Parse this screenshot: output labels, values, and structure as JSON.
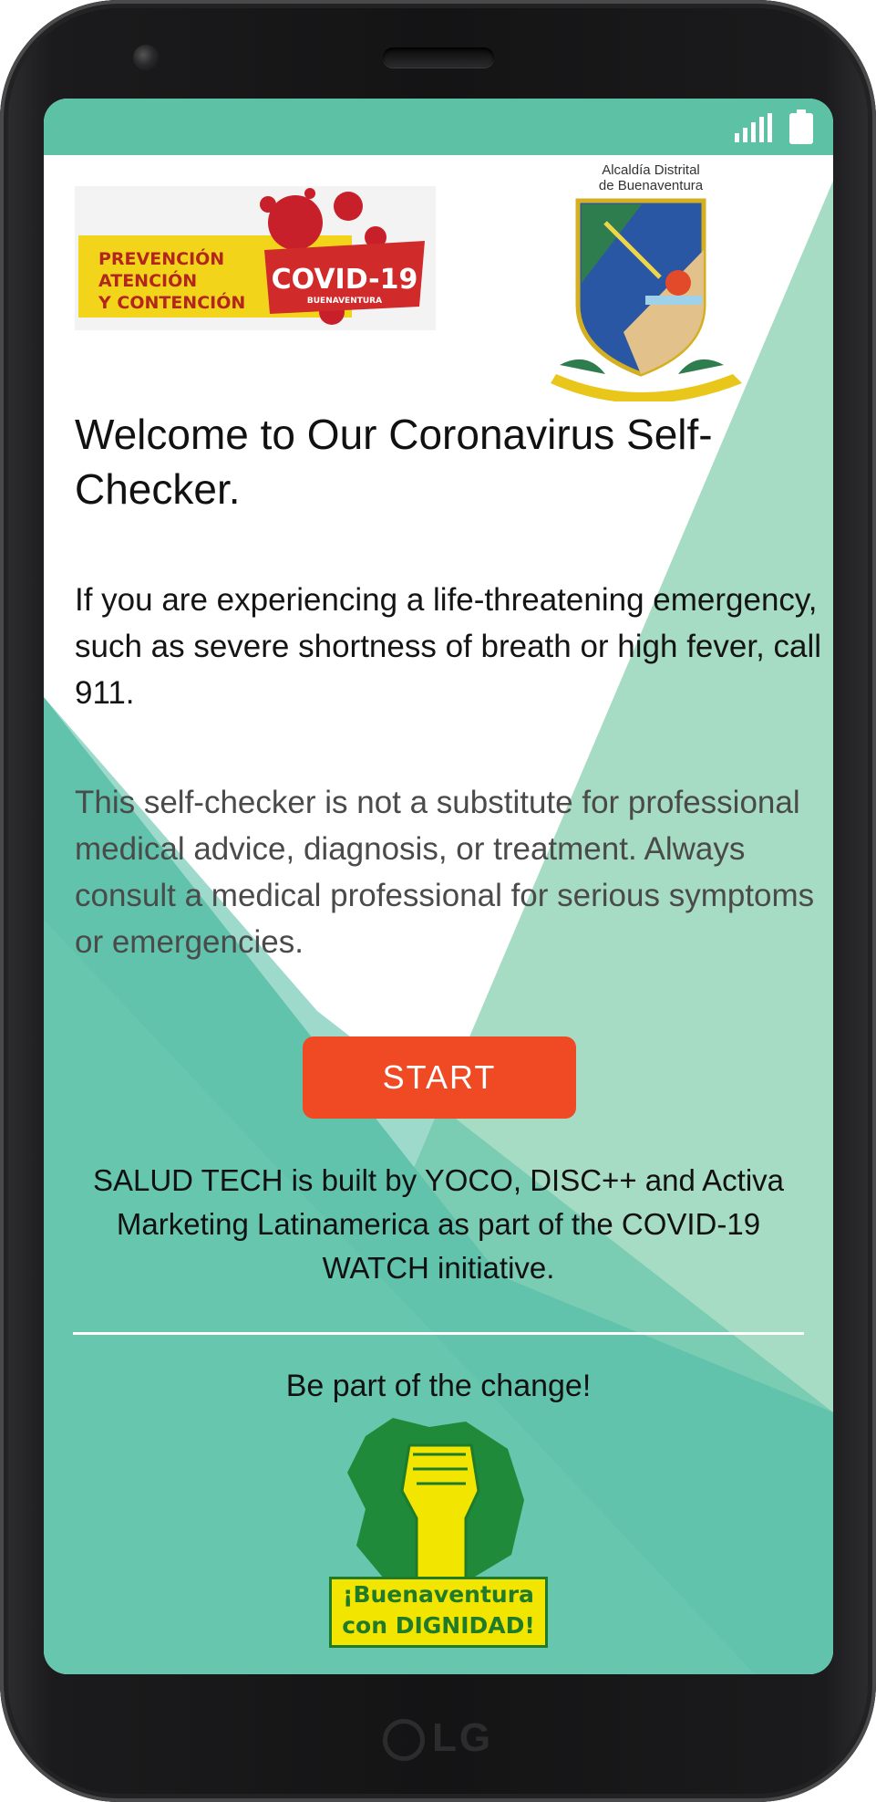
{
  "device": {
    "brand": "LG"
  },
  "status_bar": {
    "color": "#5cc1a5",
    "icons": [
      "signal-icon",
      "battery-icon"
    ]
  },
  "logos": {
    "covid": {
      "line1": "PREVENCIÓN",
      "line2": "ATENCIÓN",
      "line3": "Y CONTENCIÓN",
      "badge": "COVID-19",
      "badge_sub": "BUENAVENTURA"
    },
    "alcaldia": {
      "line1": "Alcaldía Distrital",
      "line2": "de Buenaventura"
    },
    "dignidad": {
      "line1": "¡Buenaventura",
      "line2": "con DIGNIDAD!"
    }
  },
  "main": {
    "title": "Welcome to Our Coronavirus Self-Checker.",
    "emergency_text": "If you are experiencing a life-threatening emergency, such as severe shortness of breath or high fever, call 911.",
    "disclaimer_text": "This self-checker is not a substitute for professional medical advice, diagnosis, or treatment. Always consult a medical professional for serious symptoms or emergencies.",
    "start_label": "START",
    "credits_text": "SALUD TECH is built by YOCO, DISC++ and Activa Marketing Latinamerica as part of the COVID-19 WATCH initiative.",
    "cta_text": "Be part of the change!"
  },
  "colors": {
    "accent": "#5cc1a5",
    "start_button": "#ef4a24",
    "bg_light": "#a6dcc4",
    "bg_dark": "#62c5ad"
  }
}
